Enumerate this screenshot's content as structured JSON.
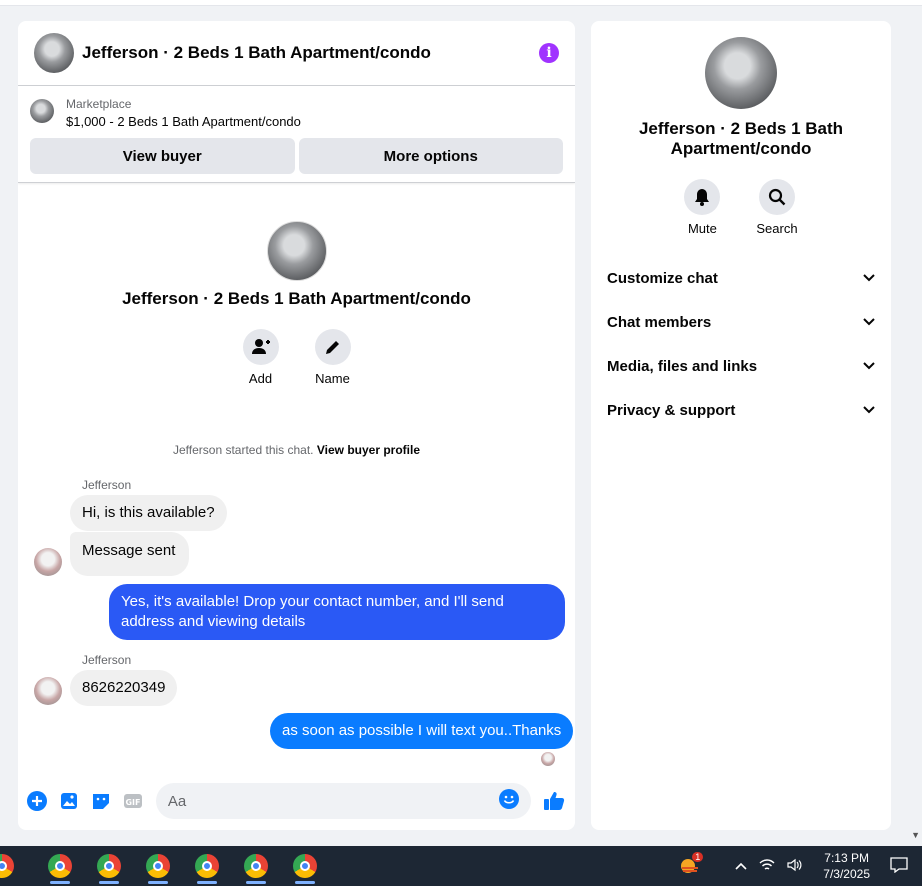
{
  "header": {
    "title": "Jefferson · 2 Beds 1 Bath Apartment/condo"
  },
  "marketplace": {
    "label": "Marketplace",
    "listing": "$1,000 - 2 Beds 1 Bath Apartment/condo",
    "view_buyer": "View buyer",
    "more_options": "More options"
  },
  "intro": {
    "title": "Jefferson · 2 Beds 1 Bath Apartment/condo",
    "add_label": "Add",
    "name_label": "Name"
  },
  "system_note": {
    "text": "Jefferson started this chat.",
    "link": "View buyer profile"
  },
  "messages": {
    "sender1": "Jefferson",
    "m1": "Hi, is this available?",
    "m2": "Message sent",
    "m3_line1": "Yes, it's available! Drop your contact number, and I'll send",
    "m3_line2": "address and viewing details",
    "sender2": "Jefferson",
    "m4": "8626220349",
    "m5": "as soon as possible I will text you..Thanks"
  },
  "composer": {
    "placeholder": "Aa",
    "gif_label": "GIF"
  },
  "side": {
    "title": "Jefferson · 2 Beds 1 Bath Apartment/condo",
    "mute_label": "Mute",
    "search_label": "Search",
    "menu": [
      "Customize chat",
      "Chat members",
      "Media, files and links",
      "Privacy & support"
    ]
  },
  "taskbar": {
    "time": "7:13 PM",
    "date": "7/3/2025",
    "badge": "1"
  },
  "colors": {
    "accent": "#0a7cff",
    "info": "#a033ff",
    "taskbar": "#1d2734"
  }
}
